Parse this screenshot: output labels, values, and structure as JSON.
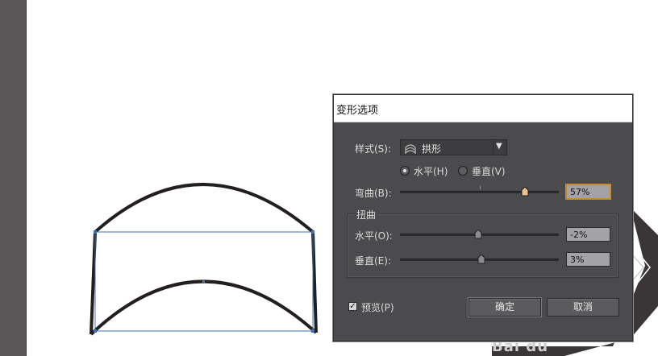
{
  "dialog": {
    "title": "变形选项",
    "style_label": "样式(S):",
    "style_value": "拱形",
    "style_icon": "arc-icon",
    "orientation": {
      "horizontal_label": "水平(H)",
      "vertical_label": "垂直(V)",
      "selected": "horizontal"
    },
    "bend_label": "弯曲(B):",
    "bend_value": "57%",
    "bend_fraction": 0.57,
    "distortion_group_label": "扭曲",
    "dist_horizontal_label": "水平(O):",
    "dist_horizontal_value": "-2%",
    "dist_horizontal_fraction": -0.02,
    "dist_vertical_label": "垂直(E):",
    "dist_vertical_value": "3%",
    "dist_vertical_fraction": 0.03,
    "preview_label": "预览(P)",
    "preview_checked": true,
    "check_glyph": "✓",
    "caret_glyph": "▼",
    "ok_label": "确定",
    "cancel_label": "取消"
  },
  "colors": {
    "dialog_bg": "#4b4a4c",
    "selection_blue": "#3f6fb5",
    "shape_stroke": "#231f20",
    "focus_orange": "#c98a2a"
  },
  "watermark": {
    "text": "Bai du"
  }
}
